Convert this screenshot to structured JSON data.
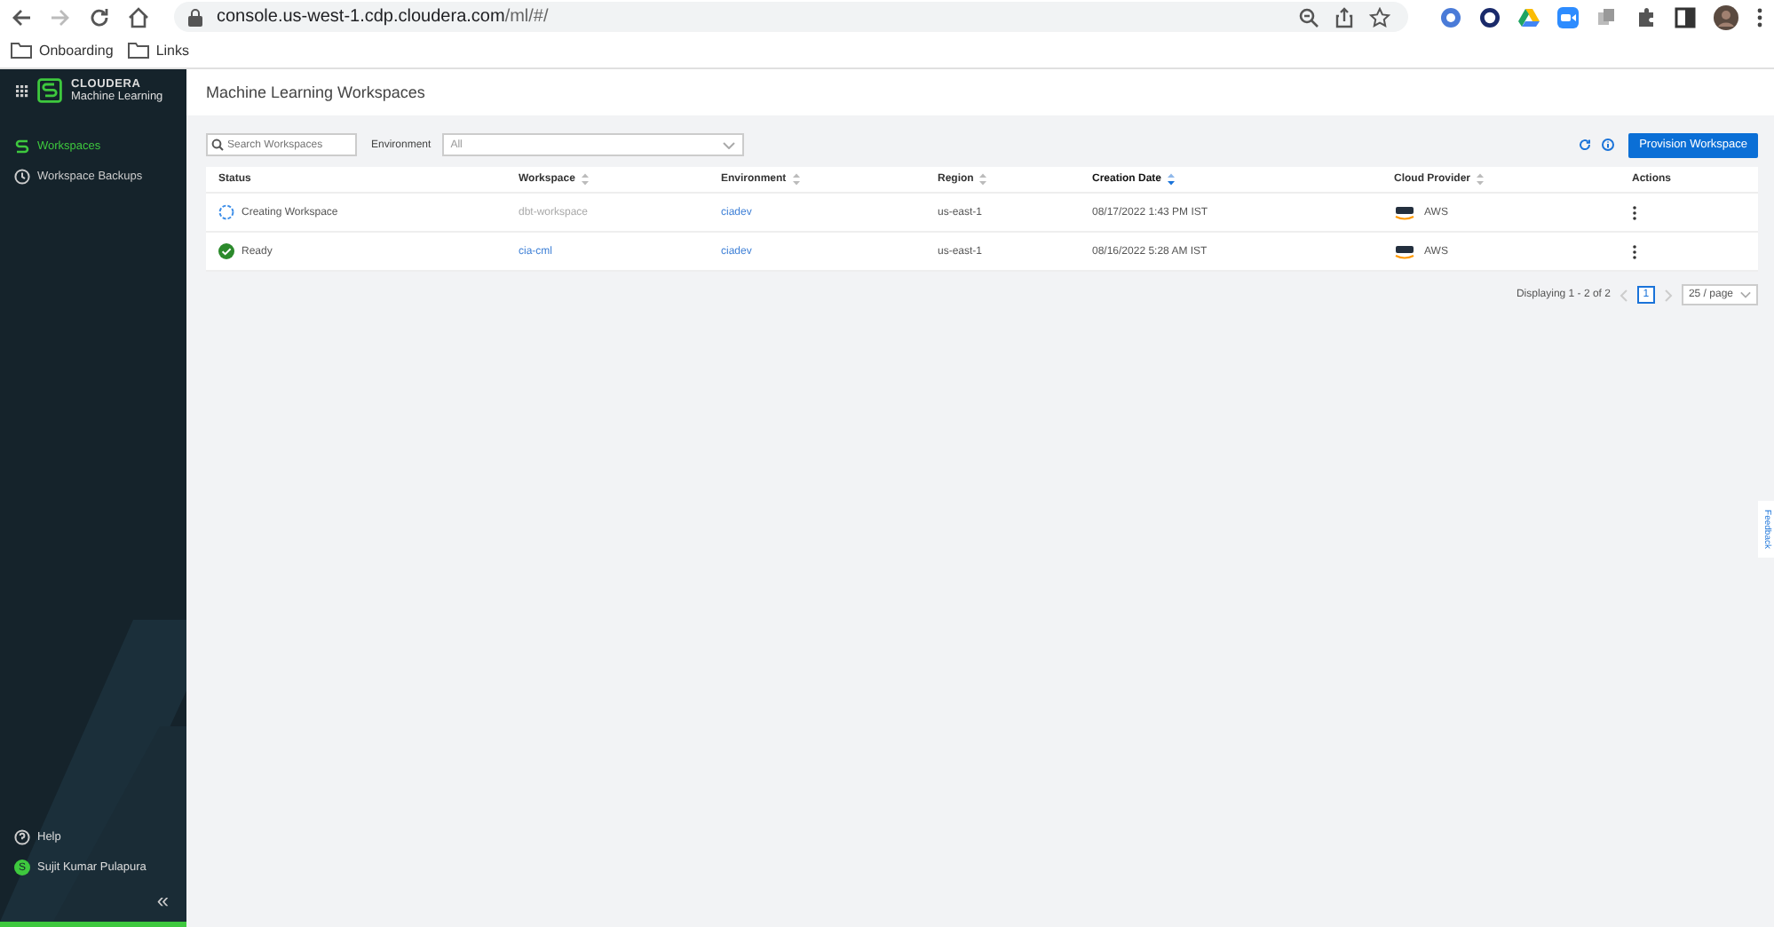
{
  "browser": {
    "url_host": "console.us-west-1.cdp.cloudera.com",
    "url_path": "/ml/#/",
    "bookmarks": [
      "Onboarding",
      "Links"
    ]
  },
  "sidebar": {
    "brand": "CLOUDERA",
    "product": "Machine Learning",
    "items": [
      {
        "label": "Workspaces",
        "selected": true
      },
      {
        "label": "Workspace Backups",
        "selected": false
      }
    ],
    "help": "Help",
    "user_initial": "S",
    "user_name": "Sujit Kumar Pulapura",
    "collapse": "«"
  },
  "page_title": "Machine Learning Workspaces",
  "search": {
    "placeholder": "Search Workspaces"
  },
  "environment_filter": {
    "label": "Environment",
    "value": "All"
  },
  "provision_button": "Provision Workspace",
  "table": {
    "columns": [
      {
        "label": "Status",
        "sortable": false,
        "sorted": false
      },
      {
        "label": "Workspace",
        "sortable": true,
        "sorted": false
      },
      {
        "label": "Environment",
        "sortable": true,
        "sorted": false
      },
      {
        "label": "Region",
        "sortable": true,
        "sorted": false
      },
      {
        "label": "Creation Date",
        "sortable": true,
        "sorted": true
      },
      {
        "label": "Cloud Provider",
        "sortable": true,
        "sorted": false
      },
      {
        "label": "Actions",
        "sortable": false,
        "sorted": false
      }
    ],
    "rows": [
      {
        "status": "Creating Workspace",
        "kind": "creating",
        "workspace": "dbt-workspace",
        "workspace_disabled": true,
        "environment": "ciadev",
        "region": "us-east-1",
        "created": "08/17/2022 1:43 PM IST",
        "provider": "AWS"
      },
      {
        "status": "Ready",
        "kind": "ready",
        "workspace": "cia-cml",
        "workspace_disabled": false,
        "environment": "ciadev",
        "region": "us-east-1",
        "created": "08/16/2022 5:28 AM IST",
        "provider": "AWS"
      }
    ]
  },
  "pagination": {
    "summary": "Displaying 1 - 2 of 2",
    "pages": [
      {
        "label": "1",
        "selected": true
      }
    ],
    "page_size": "25 / page"
  },
  "feedback_tab": "Feedback"
}
